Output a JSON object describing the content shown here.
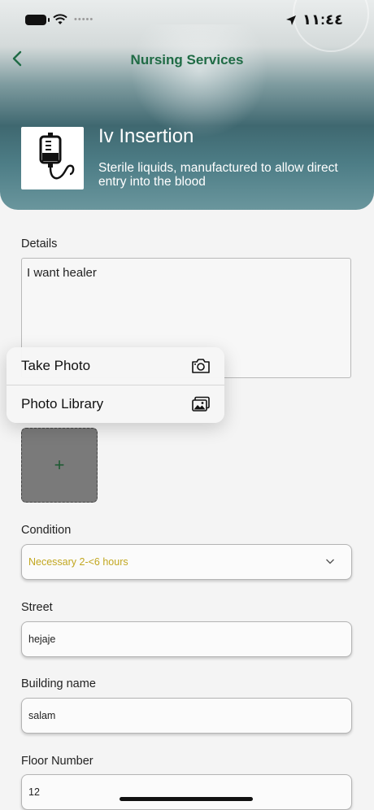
{
  "status_bar": {
    "time": "١١:٤٤",
    "signal_dots": "•••••"
  },
  "header": {
    "title": "Nursing Services"
  },
  "service": {
    "name": "Iv Insertion",
    "description": "Sterile liquids, manufactured to allow direct entry into the blood"
  },
  "form": {
    "details_label": "Details",
    "details_value": "I want healer",
    "upload_plus": "+",
    "condition_label": "Condition",
    "condition_value": "Necessary 2-<6 hours",
    "street_label": "Street",
    "street_value": "hejaje",
    "building_label": "Building name",
    "building_value": "salam",
    "floor_label": "Floor Number",
    "floor_value": "12"
  },
  "action_menu": {
    "items": [
      {
        "label": "Take Photo",
        "icon": "camera-icon"
      },
      {
        "label": "Photo Library",
        "icon": "photo-library-icon"
      }
    ]
  },
  "colors": {
    "accent": "#1f6b45",
    "select_value": "#c2a720"
  }
}
